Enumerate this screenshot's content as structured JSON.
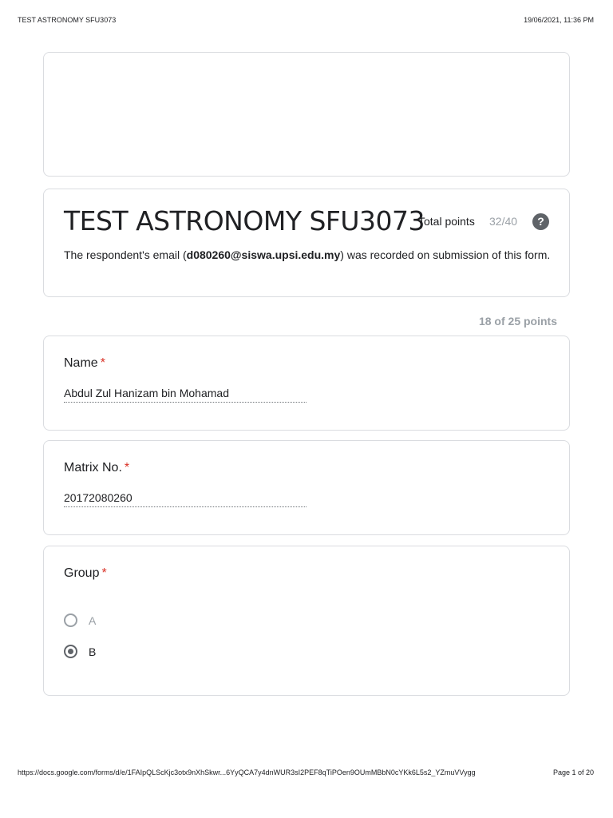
{
  "print_header": {
    "title": "TEST ASTRONOMY SFU3073",
    "datetime": "19/06/2021, 11:36 PM"
  },
  "form": {
    "title": "TEST ASTRONOMY SFU3073",
    "total_points_label": "Total points",
    "total_points_value": "32/40",
    "help_symbol": "?",
    "email_prefix": "The respondent's email (",
    "email": "d080260@siswa.upsi.edu.my",
    "email_suffix": ") was recorded on submission of this form."
  },
  "section": {
    "points": "18 of 25 points"
  },
  "questions": {
    "name": {
      "label": "Name",
      "required_mark": "*",
      "answer": "Abdul Zul Hanizam bin Mohamad"
    },
    "matrix": {
      "label": "Matrix No.",
      "required_mark": "*",
      "answer": "20172080260"
    },
    "group": {
      "label": "Group",
      "required_mark": "*",
      "options": [
        {
          "label": "A",
          "selected": false
        },
        {
          "label": "B",
          "selected": true
        }
      ]
    }
  },
  "print_footer": {
    "url": "https://docs.google.com/forms/d/e/1FAIpQLScKjc3otx9nXhSkwr...6YyQCA7y4dnWUR3sI2PEF8qTiPOen9OUmMBbN0cYKk6L5s2_YZmuVVygg",
    "page": "Page 1 of 20"
  },
  "colors": {
    "required": "#d93025",
    "muted": "#9aa0a6",
    "border": "#dadce0",
    "radio": "#5f6368"
  },
  "icons": {
    "help": "help-circle-icon",
    "radio_unchecked": "radio-unchecked-icon",
    "radio_checked": "radio-checked-icon"
  }
}
